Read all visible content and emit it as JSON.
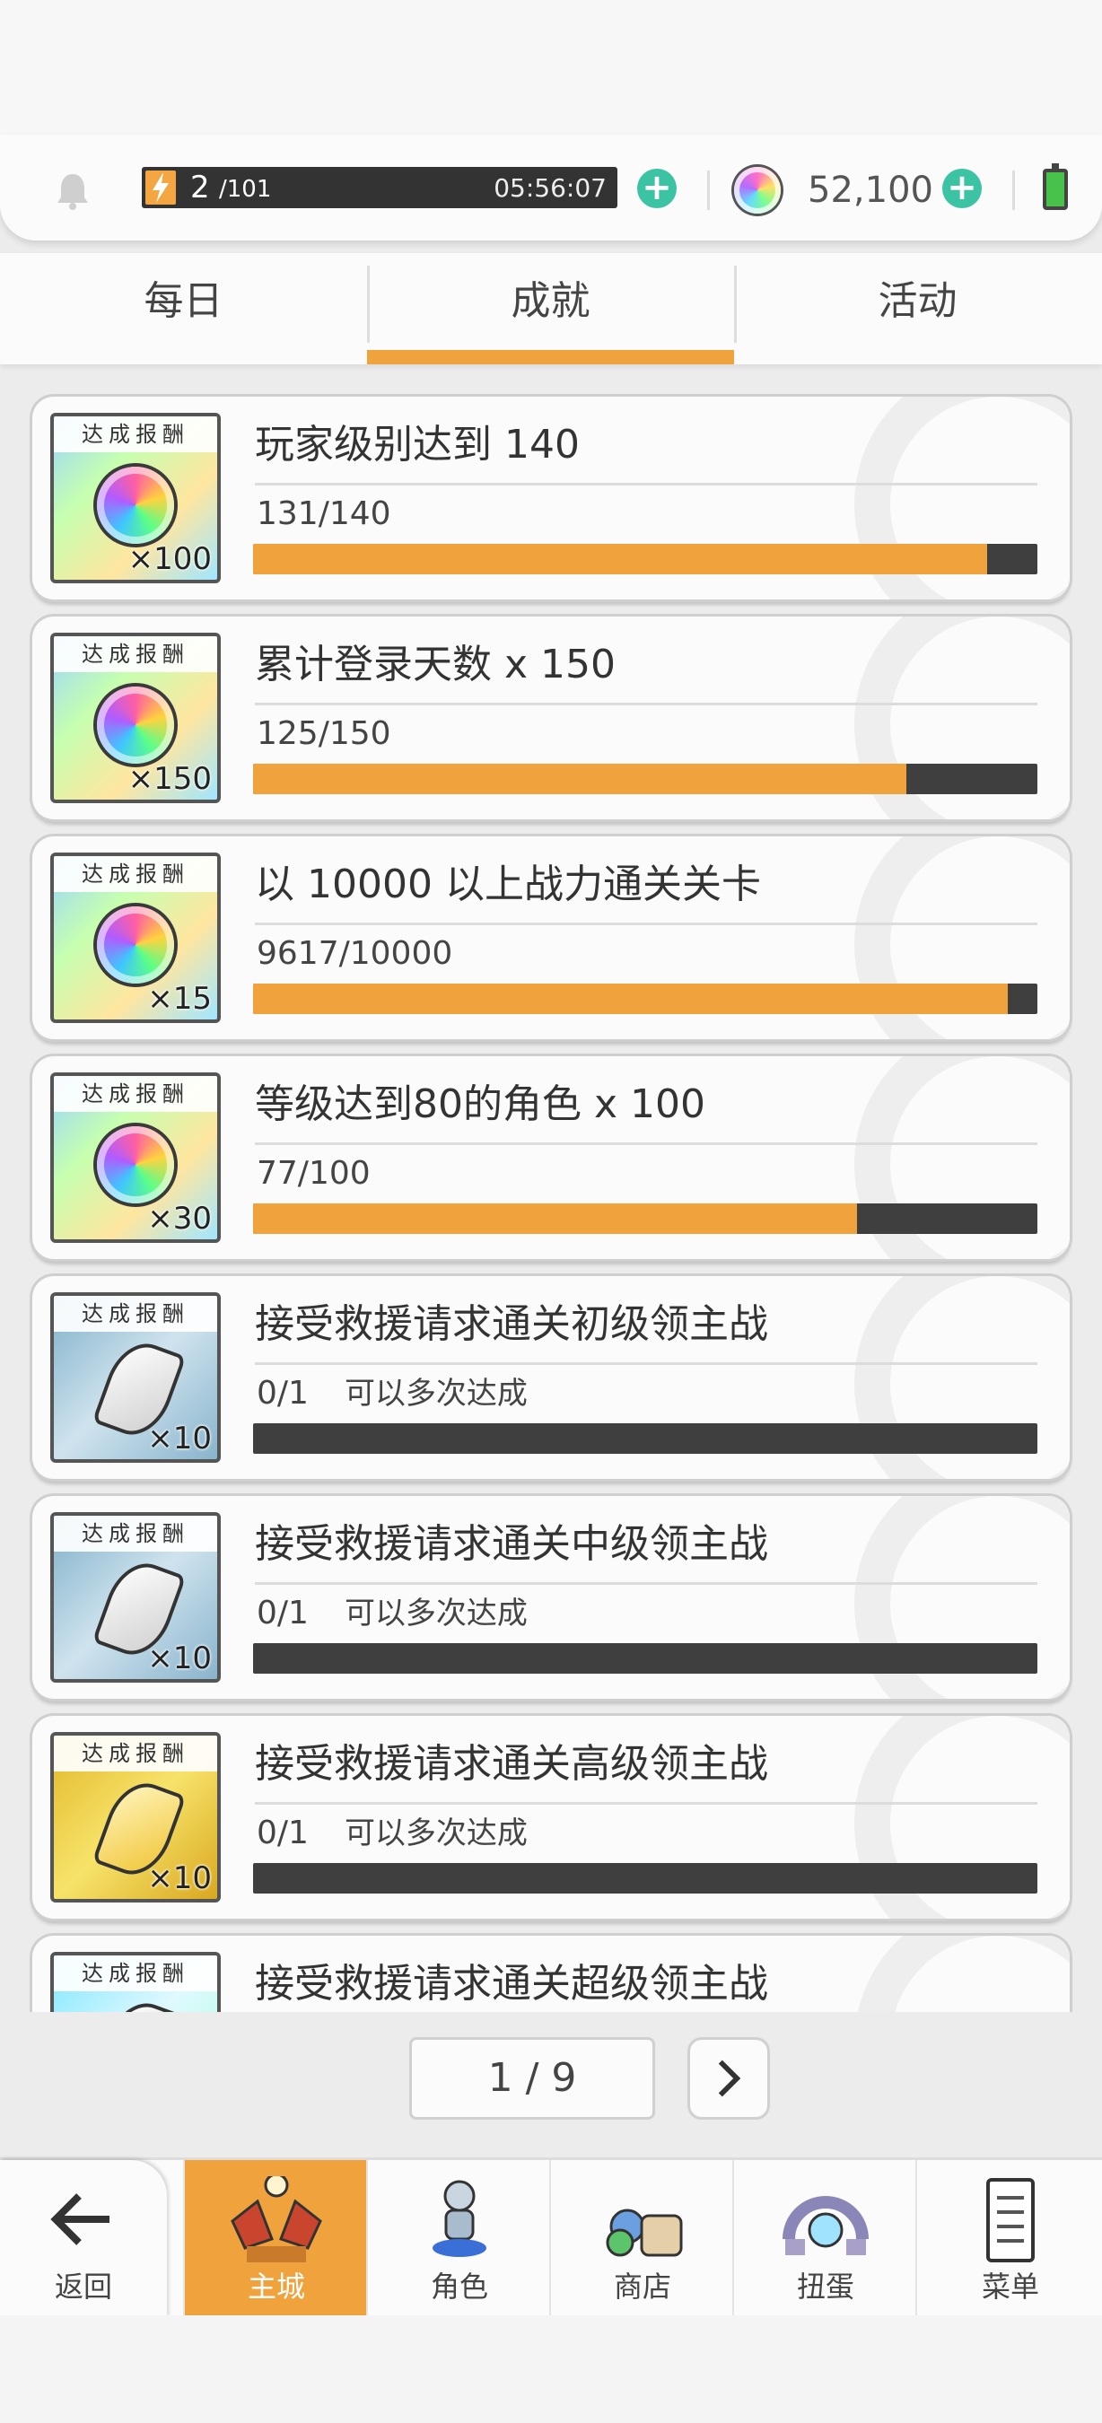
{
  "status": {
    "stamina_current": "2",
    "stamina_max": "/101",
    "stamina_timer": "05:56:07",
    "gems": "52,100"
  },
  "tabs": [
    {
      "label": "每日"
    },
    {
      "label": "成就"
    },
    {
      "label": "活动"
    }
  ],
  "reward_ribbon": "达成报酬",
  "achievements": [
    {
      "title": "玩家级别达到 140",
      "progress": "131/140",
      "note": "",
      "fill": 0.936,
      "reward_qty": "×100",
      "reward_type": "rainbow-gem-icon"
    },
    {
      "title": "累计登录天数 x 150",
      "progress": "125/150",
      "note": "",
      "fill": 0.833,
      "reward_qty": "×150",
      "reward_type": "rainbow-gem-icon"
    },
    {
      "title": "以 10000 以上战力通关关卡",
      "progress": "9617/10000",
      "note": "",
      "fill": 0.962,
      "reward_qty": "×15",
      "reward_type": "rainbow-gem-icon"
    },
    {
      "title": "等级达到80的角色 x 100",
      "progress": "77/100",
      "note": "",
      "fill": 0.77,
      "reward_qty": "×30",
      "reward_type": "rainbow-gem-icon"
    },
    {
      "title": "接受救援请求通关初级领主战",
      "progress": "0/1",
      "note": "可以多次达成",
      "fill": 0,
      "reward_qty": "×10",
      "reward_type": "silver-crystal-icon"
    },
    {
      "title": "接受救援请求通关中级领主战",
      "progress": "0/1",
      "note": "可以多次达成",
      "fill": 0,
      "reward_qty": "×10",
      "reward_type": "silver-crystal-icon"
    },
    {
      "title": "接受救援请求通关高级领主战",
      "progress": "0/1",
      "note": "可以多次达成",
      "fill": 0,
      "reward_qty": "×10",
      "reward_type": "gold-crystal-icon"
    },
    {
      "title": "接受救援请求通关超级领主战",
      "progress": "",
      "note": "",
      "fill": 0,
      "reward_qty": "",
      "reward_type": "mixed-crystal-icon"
    }
  ],
  "pager": {
    "current": "1 / 9"
  },
  "nav": {
    "back": "返回",
    "items": [
      {
        "label": "主城",
        "icon": "castle-icon"
      },
      {
        "label": "角色",
        "icon": "character-icon"
      },
      {
        "label": "商店",
        "icon": "shop-icon"
      },
      {
        "label": "扭蛋",
        "icon": "gacha-icon"
      },
      {
        "label": "菜单",
        "icon": "menu-icon"
      }
    ]
  },
  "colors": {
    "accent": "#f0a23d",
    "plus": "#3cc3a4",
    "bar_bg": "#3f3f3f"
  }
}
